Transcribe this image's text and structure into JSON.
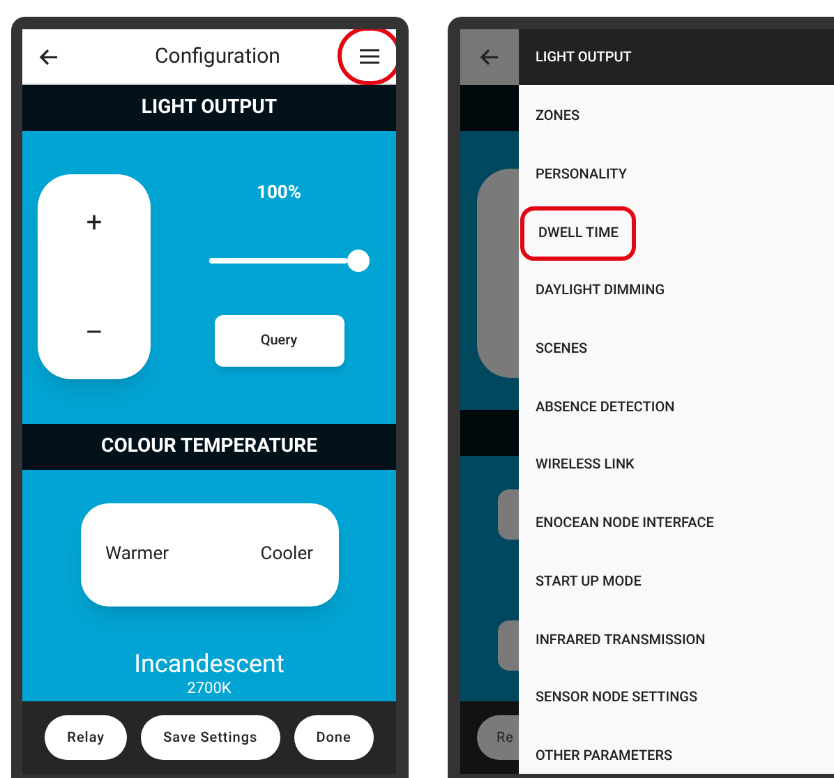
{
  "left_screen": {
    "app_bar": {
      "title": "Configuration",
      "menu_highlighted": true
    },
    "light_output": {
      "heading": "LIGHT OUTPUT",
      "plus": "+",
      "minus": "–",
      "percent": "100%",
      "level": 1,
      "query_button": "Query"
    },
    "colour_temperature": {
      "heading": "COLOUR TEMPERATURE",
      "warmer": "Warmer",
      "cooler": "Cooler",
      "preset": "Incandescent",
      "kelvin": "2700K"
    },
    "bottom_buttons": [
      "Relay",
      "Save Settings",
      "Done"
    ]
  },
  "right_screen": {
    "background_button": "Re",
    "menu": {
      "header": "LIGHT OUTPUT",
      "items": [
        {
          "label": "ZONES",
          "highlighted": false
        },
        {
          "label": "PERSONALITY",
          "highlighted": false
        },
        {
          "label": "DWELL TIME",
          "highlighted": true
        },
        {
          "label": "DAYLIGHT DIMMING",
          "highlighted": false
        },
        {
          "label": "SCENES",
          "highlighted": false
        },
        {
          "label": "ABSENCE DETECTION",
          "highlighted": false
        },
        {
          "label": "WIRELESS LINK",
          "highlighted": false
        },
        {
          "label": "ENOCEAN NODE INTERFACE",
          "highlighted": false
        },
        {
          "label": "START UP MODE",
          "highlighted": false
        },
        {
          "label": "INFRARED TRANSMISSION",
          "highlighted": false
        },
        {
          "label": "SENSOR NODE SETTINGS",
          "highlighted": false
        },
        {
          "label": "OTHER PARAMETERS",
          "highlighted": false
        }
      ]
    }
  }
}
